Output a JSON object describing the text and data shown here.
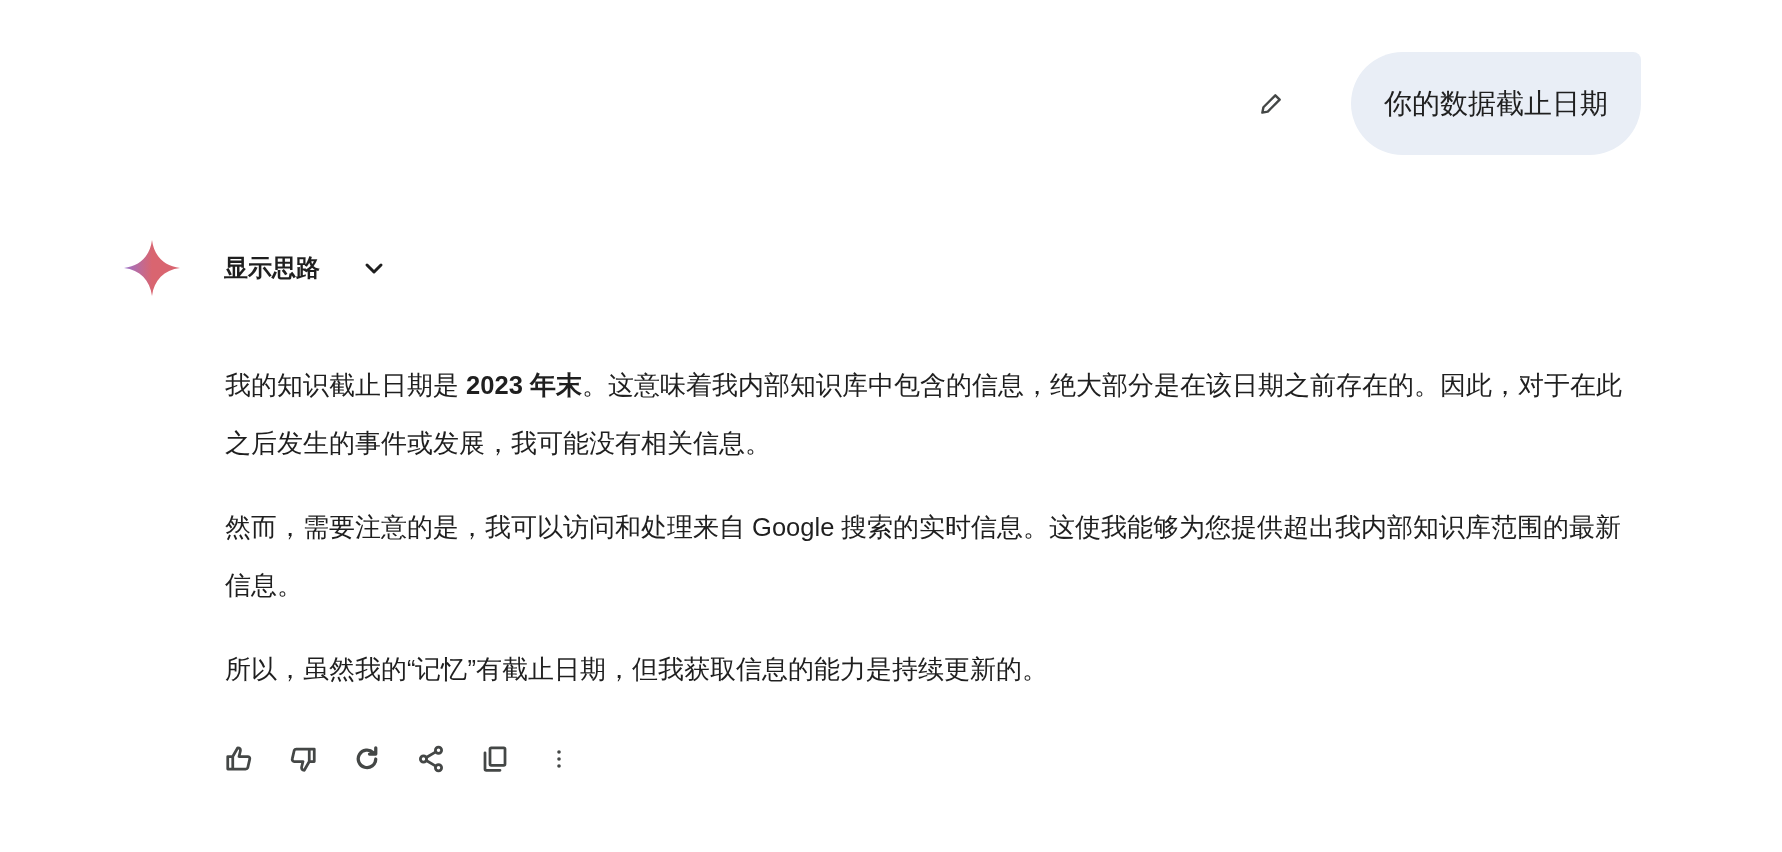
{
  "user_message": {
    "text": "你的数据截止日期"
  },
  "response": {
    "thinking_toggle": {
      "label": "显示思路",
      "expanded": false
    },
    "paragraphs": [
      "我的知识截止日期是 **2023 年末**。这意味着我内部知识库中包含的信息，绝大部分是在该日期之前存在的。因此，对于在此之后发生的事件或发展，我可能没有相关信息。",
      "然而，需要注意的是，我可以访问和处理来自 Google 搜索的实时信息。这使我能够为您提供超出我内部知识库范围的最新信息。",
      "所以，虽然我的“记忆”有截止日期，但我获取信息的能力是持续更新的。"
    ]
  }
}
